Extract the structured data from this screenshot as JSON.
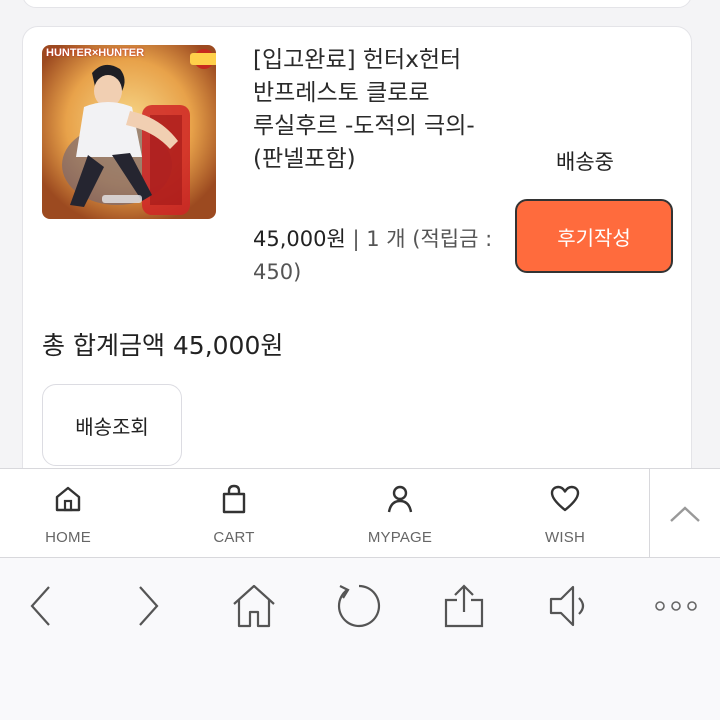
{
  "order": {
    "product_image_brand": "HUNTER×HUNTER",
    "product_name": "[입고완료] 헌터x헌터 반프레스토 클로로 루실후르 -도적의 극의- (판넬포함)",
    "price": "45,000원",
    "quantity_points": "| 1 개 (적립금 : 450)",
    "status": "배송중",
    "review_button": "후기작성",
    "total": "총 합계금액 45,000원",
    "track_button": "배송조회"
  },
  "app_nav": {
    "items": [
      {
        "label": "HOME",
        "icon": "home-icon"
      },
      {
        "label": "CART",
        "icon": "bag-icon"
      },
      {
        "label": "MYPAGE",
        "icon": "user-icon"
      },
      {
        "label": "WISH",
        "icon": "heart-icon"
      }
    ],
    "scroll_top_icon": "chevron-up-icon"
  },
  "browser_toolbar": {
    "icons": [
      "back-arrow-icon",
      "forward-arrow-icon",
      "home-icon",
      "reload-icon",
      "share-icon",
      "sound-icon",
      "more-icon"
    ]
  },
  "colors": {
    "accent": "#ff6b3d",
    "page_background": "#f4f4f6",
    "card_border": "#e4e4e8"
  }
}
